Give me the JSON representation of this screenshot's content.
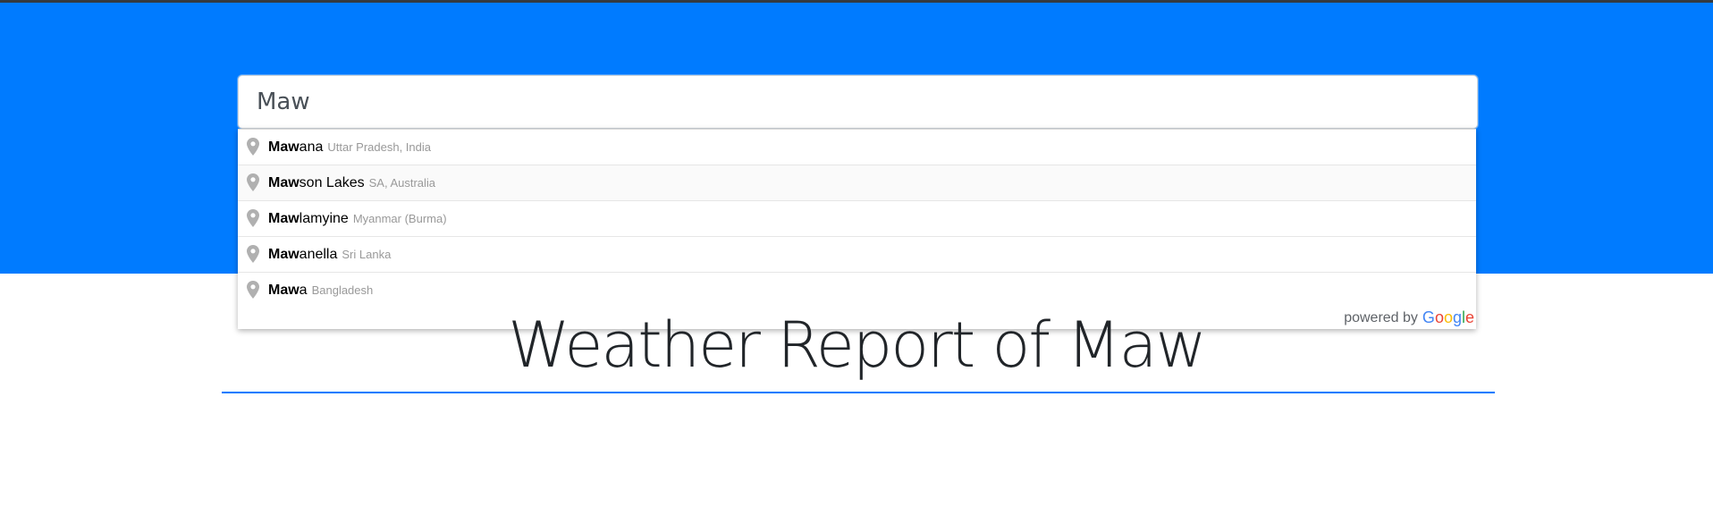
{
  "search": {
    "value": "Maw",
    "placeholder": ""
  },
  "suggestions": [
    {
      "match": "Maw",
      "rest": "ana",
      "secondary": "Uttar Pradesh, India"
    },
    {
      "match": "Maw",
      "rest": "son Lakes",
      "secondary": "SA, Australia"
    },
    {
      "match": "Maw",
      "rest": "lamyine",
      "secondary": "Myanmar (Burma)"
    },
    {
      "match": "Maw",
      "rest": "anella",
      "secondary": "Sri Lanka"
    },
    {
      "match": "Maw",
      "rest": "a",
      "secondary": "Bangladesh"
    }
  ],
  "powered_by": {
    "text": "powered by",
    "logo_letters": [
      "G",
      "o",
      "o",
      "g",
      "l",
      "e"
    ]
  },
  "page_title": "Weather Report of Maw",
  "colors": {
    "hero": "#007bff",
    "accent": "#007bff"
  },
  "icons": {
    "suggestion": "map-pin-icon"
  }
}
